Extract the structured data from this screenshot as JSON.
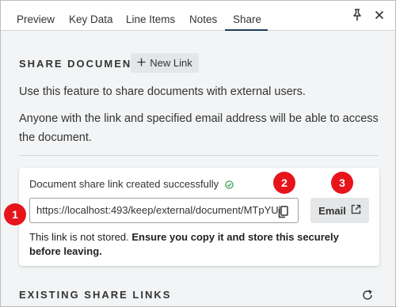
{
  "tabs": [
    {
      "label": "Preview"
    },
    {
      "label": "Key Data"
    },
    {
      "label": "Line Items"
    },
    {
      "label": "Notes"
    },
    {
      "label": "Share"
    }
  ],
  "active_tab": "Share",
  "header_icons": [
    "pin-icon",
    "close-icon"
  ],
  "share": {
    "section_title": "SHARE DOCUMENT",
    "new_link_label": "New Link",
    "intro": "Use this feature to share documents with external users.",
    "access_note": "Anyone with the link and specified email address will be able to access the document.",
    "card": {
      "success_text": "Document share link created successfully",
      "link_value": "https://localhost:493/keep/external/document/MTpYUl",
      "email_label": "Email",
      "warning_plain": "This link is not stored. ",
      "warning_bold": "Ensure you copy it and store this securely before leaving."
    }
  },
  "existing": {
    "section_title": "EXISTING SHARE LINKS"
  },
  "callouts": [
    "1",
    "2",
    "3"
  ],
  "colors": {
    "accent": "#1f3e5a",
    "callout": "#e8141b",
    "success": "#2e9a4a"
  }
}
